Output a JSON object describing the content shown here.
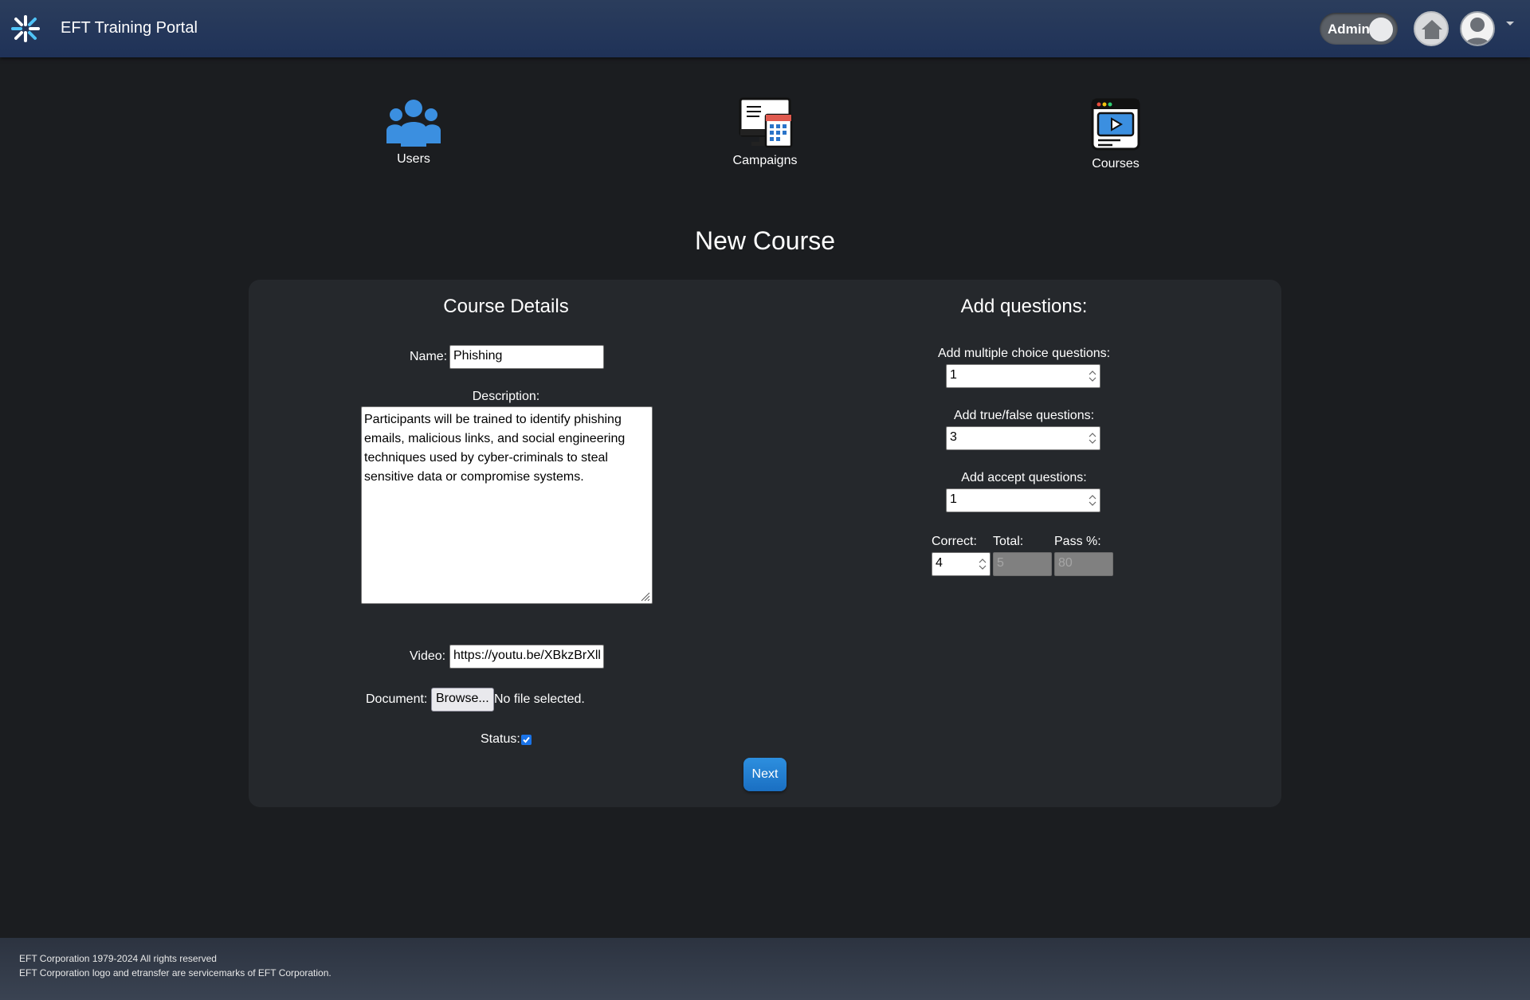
{
  "app": {
    "title": "EFT Training Portal",
    "logo_icon": "asterisk-logo-icon"
  },
  "header": {
    "admin_toggle_label": "Admin",
    "home_icon": "home-icon",
    "profile_icon": "user-avatar-icon"
  },
  "nav": {
    "users_label": "Users",
    "campaigns_label": "Campaigns",
    "courses_label": "Courses"
  },
  "page": {
    "title": "New Course"
  },
  "course_details": {
    "section_title": "Course Details",
    "name_label": "Name:",
    "name_value": "Phishing",
    "description_label": "Description:",
    "description_value": "Participants will be trained to identify phishing emails, malicious links, and social engineering techniques used by cyber-criminals to steal sensitive data or compromise systems.",
    "video_label": "Video:",
    "video_value": "https://youtu.be/XBkzBrXll",
    "document_label": "Document:",
    "browse_label": "Browse...",
    "file_status": "No file selected.",
    "status_label": "Status:",
    "status_checked": true,
    "next_label": "Next"
  },
  "questions": {
    "section_title": "Add questions:",
    "multiple_choice_label": "Add multiple choice questions:",
    "multiple_choice_value": "1",
    "true_false_label": "Add true/false questions:",
    "true_false_value": "3",
    "accept_label": "Add accept questions:",
    "accept_value": "1",
    "correct_label": "Correct:",
    "correct_value": "4",
    "total_label": "Total:",
    "total_value": "5",
    "pass_label": "Pass %:",
    "pass_value": "80"
  },
  "footer": {
    "line1": "EFT Corporation 1979-2024 All rights reserved",
    "line2": "EFT Corporation logo and etransfer are servicemarks of EFT Corporation."
  },
  "colors": {
    "header_bg": "#1f3258",
    "page_bg": "#1b1d20",
    "card_bg": "#25282c",
    "accent_blue": "#1a73e8",
    "next_button": "#2d8fdf"
  }
}
